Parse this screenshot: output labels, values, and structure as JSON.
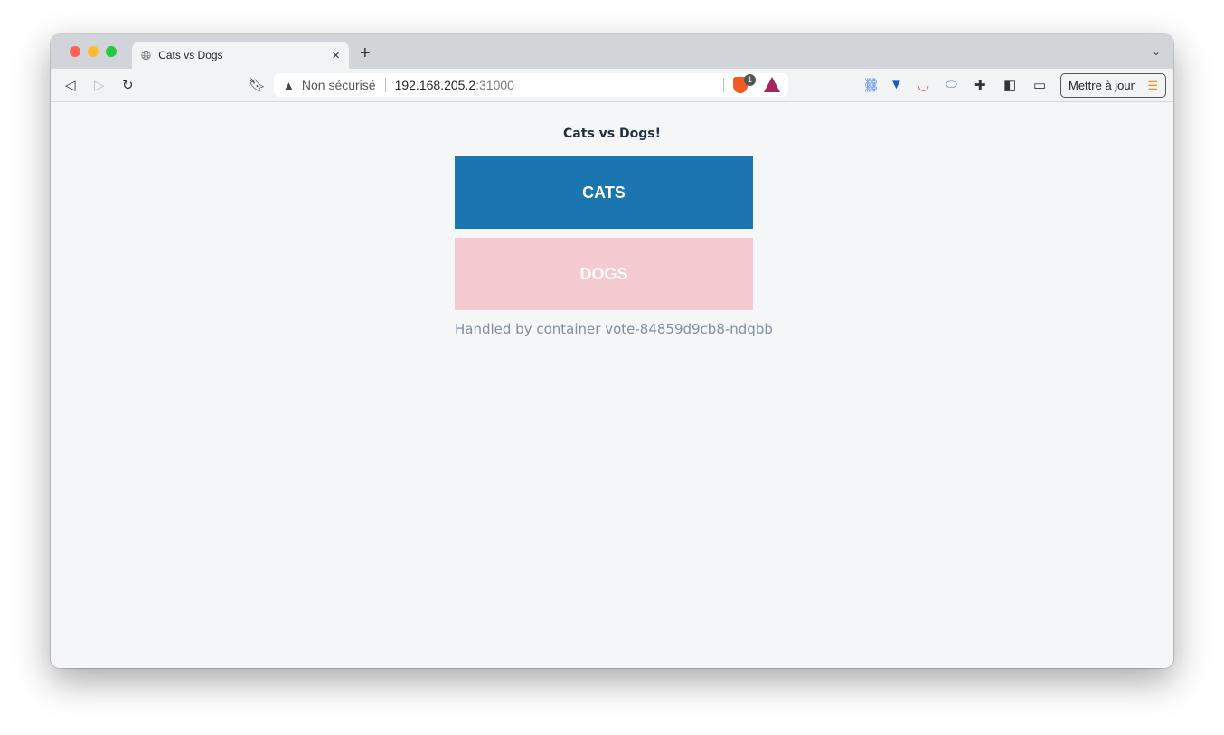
{
  "browser": {
    "tab_title": "Cats vs Dogs",
    "security_label": "Non sécurisé",
    "url_host": "192.168.205.2",
    "url_port": ":31000",
    "brave_badge": "1",
    "update_button": "Mettre à jour"
  },
  "page": {
    "heading": "Cats vs Dogs!",
    "option_a": "CATS",
    "option_b": "DOGS",
    "footer": "Handled by container vote-84859d9cb8-ndqbb"
  },
  "colors": {
    "cats": "#1a75b0",
    "dogs": "#f4c9d0",
    "background": "#f5f6f8"
  }
}
